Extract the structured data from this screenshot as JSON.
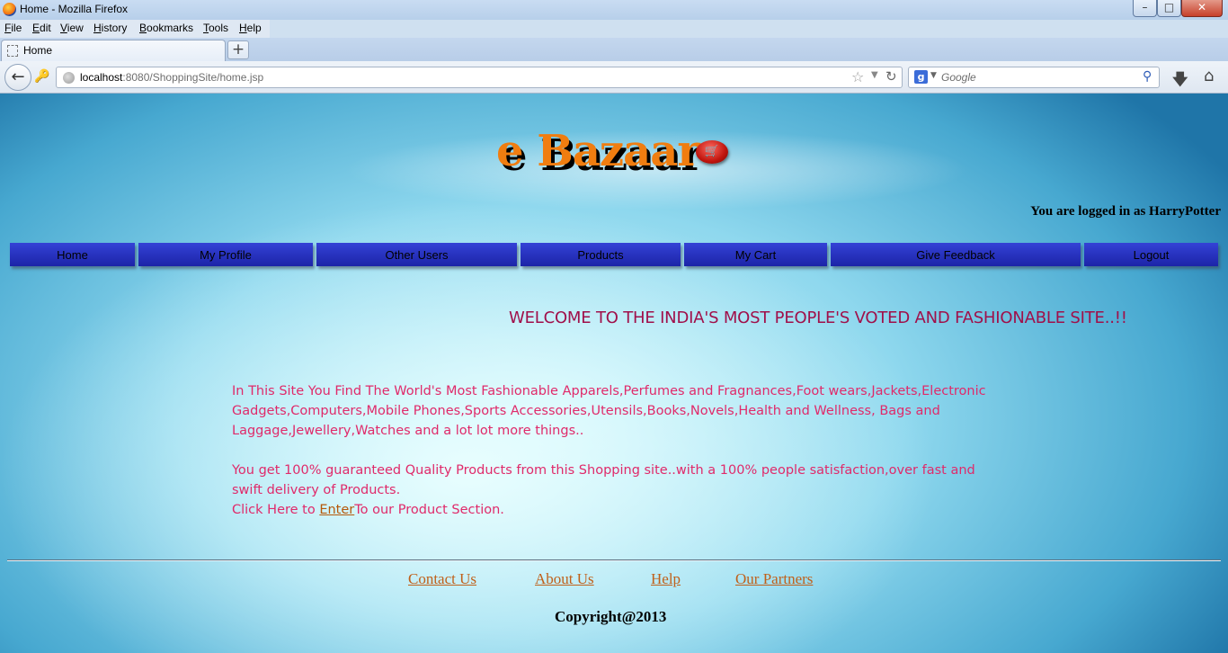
{
  "window": {
    "title": "Home - Mozilla Firefox",
    "minimize": "–",
    "maximize": "□",
    "close": "✕"
  },
  "menubar": {
    "items": [
      {
        "u": "F",
        "rest": "ile"
      },
      {
        "u": "E",
        "rest": "dit"
      },
      {
        "u": "V",
        "rest": "iew"
      },
      {
        "u": "H",
        "rest": "istory"
      },
      {
        "u": "B",
        "rest": "ookmarks"
      },
      {
        "u": "T",
        "rest": "ools"
      },
      {
        "u": "H",
        "rest": "elp"
      }
    ]
  },
  "tabs": [
    {
      "label": "Home"
    }
  ],
  "newtab_label": "+",
  "address": {
    "host": "localhost",
    "rest": ":8080/ShoppingSite/home.jsp"
  },
  "search": {
    "placeholder": "Google",
    "engine_letter": "g"
  },
  "icons": {
    "back": "back-arrow-icon",
    "key": "site-identity-icon",
    "star": "bookmark-star-icon",
    "reload": "reload-icon",
    "search": "magnifier-icon",
    "download": "download-arrow-icon",
    "home": "home-icon",
    "cart": "shopping-cart-icon"
  },
  "site": {
    "logo": "e Bazaar",
    "login_status": "You are logged in as HarryPotter",
    "nav": [
      "Home",
      "My Profile",
      "Other Users",
      "Products",
      "My Cart",
      "Give Feedback",
      "Logout"
    ],
    "welcome": "WELCOME TO THE INDIA'S MOST PEOPLE'S VOTED AND FASHIONABLE SITE..!!",
    "desc1": "In This Site You Find The World's Most Fashionable Apparels,Perfumes and Fragnances,Foot wears,Jackets,Electronic Gadgets,Computers,Mobile Phones,Sports Accessories,Utensils,Books,Novels,Health and Wellness, Bags and Laggage,Jewellery,Watches and a lot lot more things..",
    "desc2": "You get 100% guaranteed Quality Products from this Shopping site..with a 100% people satisfaction,over fast and swift delivery of Products.",
    "click_prefix": "Click Here to ",
    "enter_link": "Enter",
    "click_suffix": "To our Product Section.",
    "footer_links": [
      "Contact Us",
      "About Us",
      "Help",
      "Our Partners"
    ],
    "copyright": "Copyright@2013"
  },
  "colors": {
    "nav_button": "#2a34c4",
    "welcome_text": "#a0104a",
    "description_text": "#e02a6a",
    "link": "#c0601a",
    "logo": "#f07d10"
  }
}
